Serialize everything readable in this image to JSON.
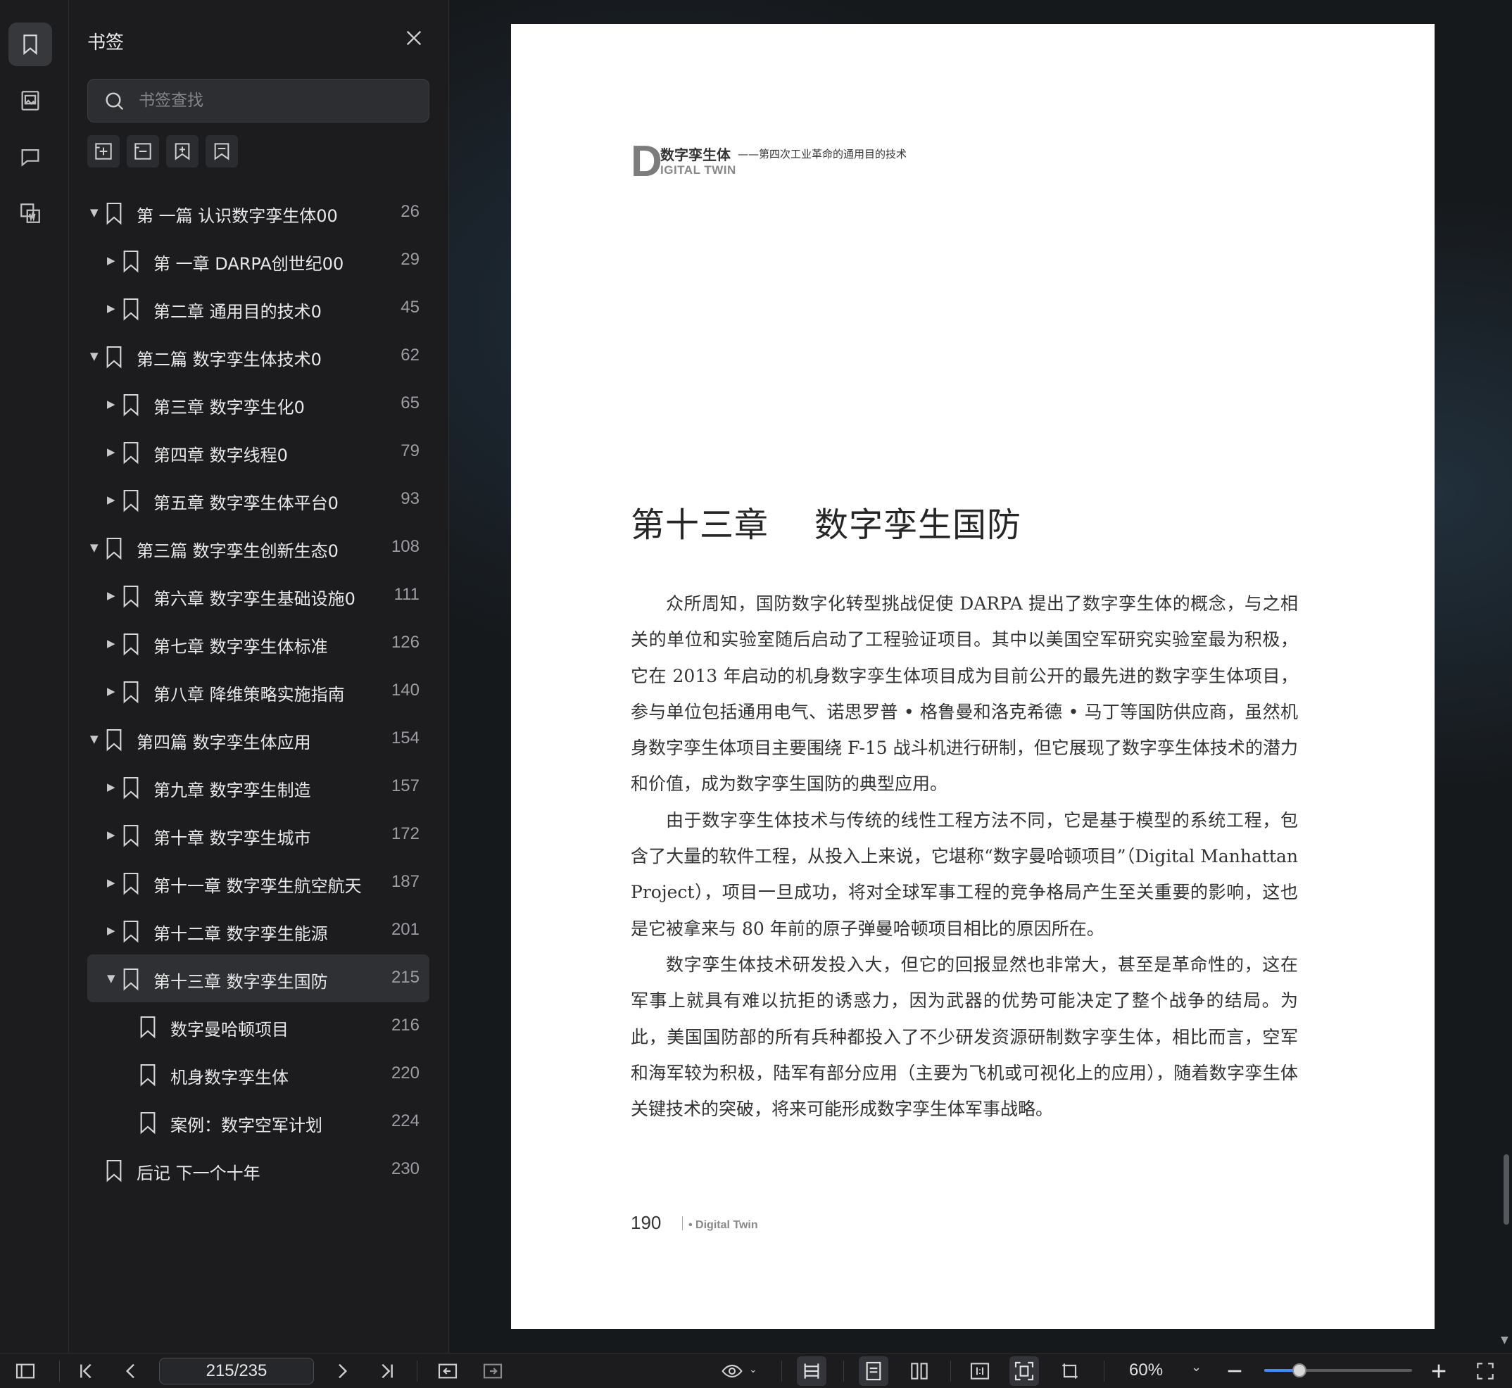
{
  "sidebar": {
    "title": "书签",
    "search_placeholder": "书签查找",
    "rail_icons": [
      "bookmark-icon",
      "image-icon",
      "comment-icon",
      "word-export-icon"
    ],
    "tools": [
      "add-bookmark-icon",
      "remove-bookmark-icon",
      "add-child-bookmark-icon",
      "bookmark-outline-icon"
    ],
    "bookmarks": [
      {
        "label": "第 一篇 认识数字孪生体00",
        "page": "26",
        "level": 0,
        "caret": "▼"
      },
      {
        "label": "第 一章 DARPA创世纪00",
        "page": "29",
        "level": 1,
        "caret": "▶"
      },
      {
        "label": "第二章 通用目的技术0",
        "page": "45",
        "level": 1,
        "caret": "▶"
      },
      {
        "label": "第二篇 数字孪生体技术0",
        "page": "62",
        "level": 0,
        "caret": "▼"
      },
      {
        "label": "第三章 数字孪生化0",
        "page": "65",
        "level": 1,
        "caret": "▶"
      },
      {
        "label": "第四章 数字线程0",
        "page": "79",
        "level": 1,
        "caret": "▶"
      },
      {
        "label": "第五章 数字孪生体平台0",
        "page": "93",
        "level": 1,
        "caret": "▶"
      },
      {
        "label": "第三篇 数字孪生创新生态0",
        "page": "108",
        "level": 0,
        "caret": "▼"
      },
      {
        "label": "第六章 数字孪生基础设施0",
        "page": "111",
        "level": 1,
        "caret": "▶"
      },
      {
        "label": "第七章 数字孪生体标准",
        "page": "126",
        "level": 1,
        "caret": "▶"
      },
      {
        "label": "第八章 降维策略实施指南",
        "page": "140",
        "level": 1,
        "caret": "▶"
      },
      {
        "label": "第四篇 数字孪生体应用",
        "page": "154",
        "level": 0,
        "caret": "▼"
      },
      {
        "label": "第九章 数字孪生制造",
        "page": "157",
        "level": 1,
        "caret": "▶"
      },
      {
        "label": "第十章 数字孪生城市",
        "page": "172",
        "level": 1,
        "caret": "▶"
      },
      {
        "label": "第十一章 数字孪生航空航天",
        "page": "187",
        "level": 1,
        "caret": "▶"
      },
      {
        "label": "第十二章 数字孪生能源",
        "page": "201",
        "level": 1,
        "caret": "▶"
      },
      {
        "label": "第十三章 数字孪生国防",
        "page": "215",
        "level": 1,
        "caret": "▼",
        "selected": true
      },
      {
        "label": "数字曼哈顿项目",
        "page": "216",
        "level": 2,
        "caret": ""
      },
      {
        "label": "机身数字孪生体",
        "page": "220",
        "level": 2,
        "caret": ""
      },
      {
        "label": "案例：数字空军计划",
        "page": "224",
        "level": 2,
        "caret": ""
      },
      {
        "label": "后记 下一个十年",
        "page": "230",
        "level": 0,
        "caret": ""
      }
    ]
  },
  "document": {
    "header_logo_letter": "D",
    "header_cn": "数字孪生体",
    "header_en": "IGITAL TWIN",
    "header_subtitle": "——第四次工业革命的通用目的技术",
    "chapter_title": "第十三章    数字孪生国防",
    "paragraphs": [
      "众所周知，国防数字化转型挑战促使 DARPA 提出了数字孪生体的概念，与之相关的单位和实验室随后启动了工程验证项目。其中以美国空军研究实验室最为积极，它在 2013 年启动的机身数字孪生体项目成为目前公开的最先进的数字孪生体项目，参与单位包括通用电气、诺思罗普 • 格鲁曼和洛克希德 • 马丁等国防供应商，虽然机身数字孪生体项目主要围绕 F-15 战斗机进行研制，但它展现了数字孪生体技术的潜力和价值，成为数字孪生国防的典型应用。",
      "由于数字孪生体技术与传统的线性工程方法不同，它是基于模型的系统工程，包含了大量的软件工程，从投入上来说，它堪称“数字曼哈顿项目”（Digital Manhattan Project），项目一旦成功，将对全球军事工程的竞争格局产生至关重要的影响，这也是它被拿来与 80 年前的原子弹曼哈顿项目相比的原因所在。",
      "数字孪生体技术研发投入大，但它的回报显然也非常大，甚至是革命性的，这在军事上就具有难以抗拒的诱惑力，因为武器的优势可能决定了整个战争的结局。为此，美国国防部的所有兵种都投入了不少研发资源研制数字孪生体，相比而言，空军和海军较为积极，陆军有部分应用（主要为飞机或可视化上的应用），随着数字孪生体关键技术的突破，将来可能形成数字孪生体军事战略。"
    ],
    "folio_number": "190",
    "folio_brand": "• Digital Twin"
  },
  "toolbar": {
    "page_indicator": "215/235",
    "zoom": "60%",
    "zoom_fraction": 0.24
  }
}
